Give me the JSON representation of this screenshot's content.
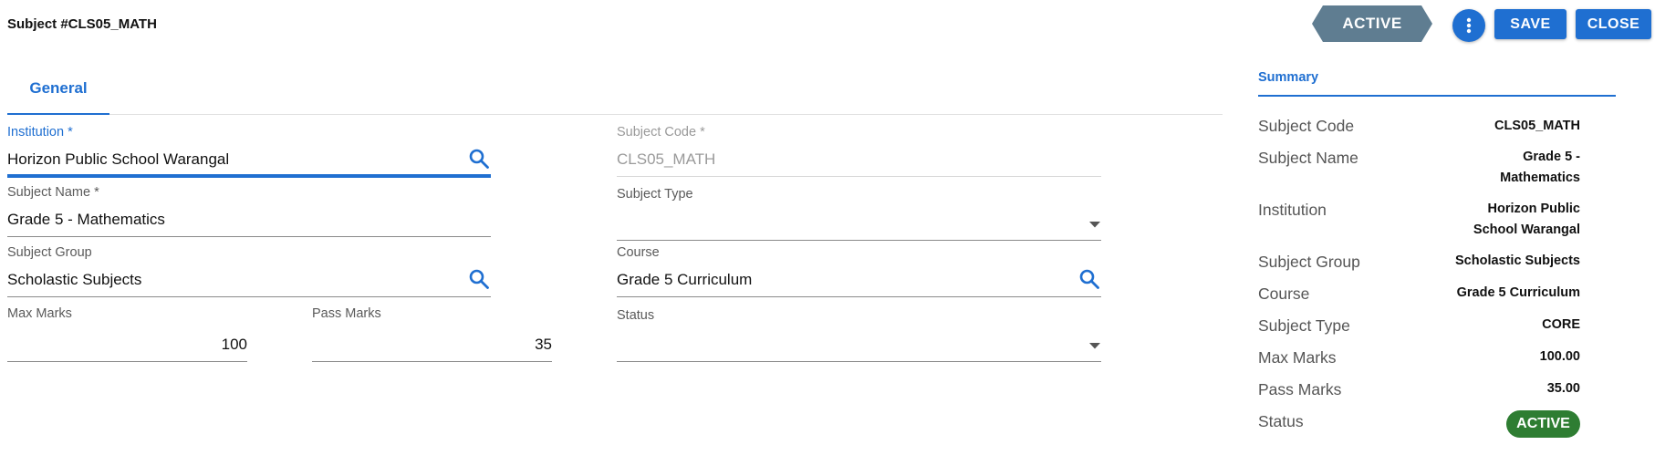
{
  "header": {
    "title": "Subject #CLS05_MATH",
    "status_label": "ACTIVE",
    "more_icon": "more-vertical-icon",
    "save_label": "SAVE",
    "close_label": "CLOSE"
  },
  "tabs": [
    {
      "label": "General",
      "active": true
    }
  ],
  "form": {
    "institution": {
      "label": "Institution *",
      "value": "Horizon Public School Warangal"
    },
    "subject_code": {
      "label": "Subject Code *",
      "value": "CLS05_MATH"
    },
    "subject_name": {
      "label": "Subject Name *",
      "value": "Grade 5 - Mathematics"
    },
    "subject_type": {
      "label": "Subject Type",
      "value": ""
    },
    "subject_group": {
      "label": "Subject Group",
      "value": "Scholastic Subjects"
    },
    "course": {
      "label": "Course",
      "value": "Grade 5 Curriculum"
    },
    "max_marks": {
      "label": "Max Marks",
      "value": "100"
    },
    "pass_marks": {
      "label": "Pass Marks",
      "value": "35"
    },
    "status": {
      "label": "Status",
      "value": ""
    }
  },
  "summary": {
    "title": "Summary",
    "rows": [
      {
        "label": "Subject Code",
        "value": "CLS05_MATH"
      },
      {
        "label": "Subject Name",
        "value_line1": "Grade 5 -",
        "value_line2": "Mathematics"
      },
      {
        "label": "Institution",
        "value_line1": "Horizon Public",
        "value_line2": "School Warangal"
      },
      {
        "label": "Subject Group",
        "value": "Scholastic Subjects"
      },
      {
        "label": "Course",
        "value": "Grade 5 Curriculum"
      },
      {
        "label": "Subject Type",
        "value": "CORE"
      },
      {
        "label": "Max Marks",
        "value": "100.00"
      },
      {
        "label": "Pass Marks",
        "value": "35.00"
      },
      {
        "label": "Status",
        "value": "ACTIVE"
      }
    ]
  },
  "colors": {
    "primary": "#1f6fd1",
    "status_ribbon": "#5f7d91",
    "active_badge": "#2e7d32"
  }
}
